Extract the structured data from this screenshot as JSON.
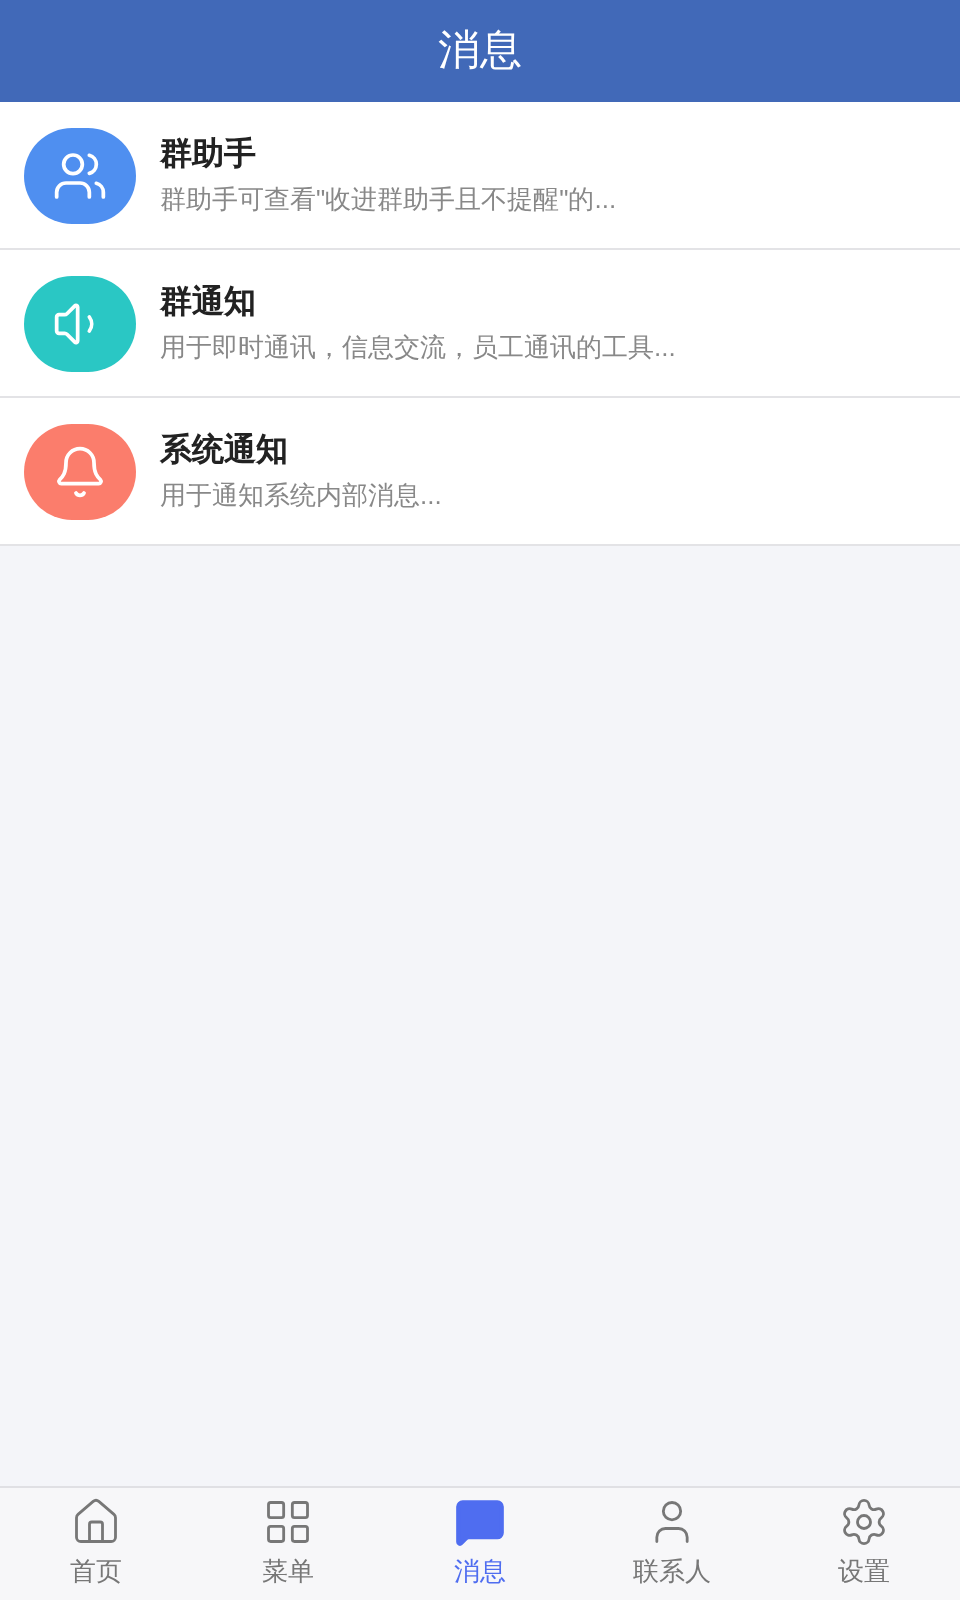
{
  "header": {
    "title": "消息"
  },
  "messages": [
    {
      "kind": "group",
      "title": "群助手",
      "preview": "群助手可查看\"收进群助手且不提醒\"的...",
      "color": "#4f8ff0"
    },
    {
      "kind": "speaker",
      "title": "群通知",
      "preview": "用于即时通讯，信息交流，员工通讯的工具...",
      "color": "#2ac7c4"
    },
    {
      "kind": "bell",
      "title": "系统通知",
      "preview": "用于通知系统内部消息...",
      "color": "#fb7d6c"
    }
  ],
  "tab_bar": [
    {
      "kind": "home",
      "label": "首页",
      "selected": false
    },
    {
      "kind": "grid",
      "label": "菜单",
      "selected": false
    },
    {
      "kind": "chat",
      "label": "消息",
      "selected": true
    },
    {
      "kind": "person",
      "label": "联系人",
      "selected": false
    },
    {
      "kind": "gear",
      "label": "设置",
      "selected": false
    }
  ]
}
